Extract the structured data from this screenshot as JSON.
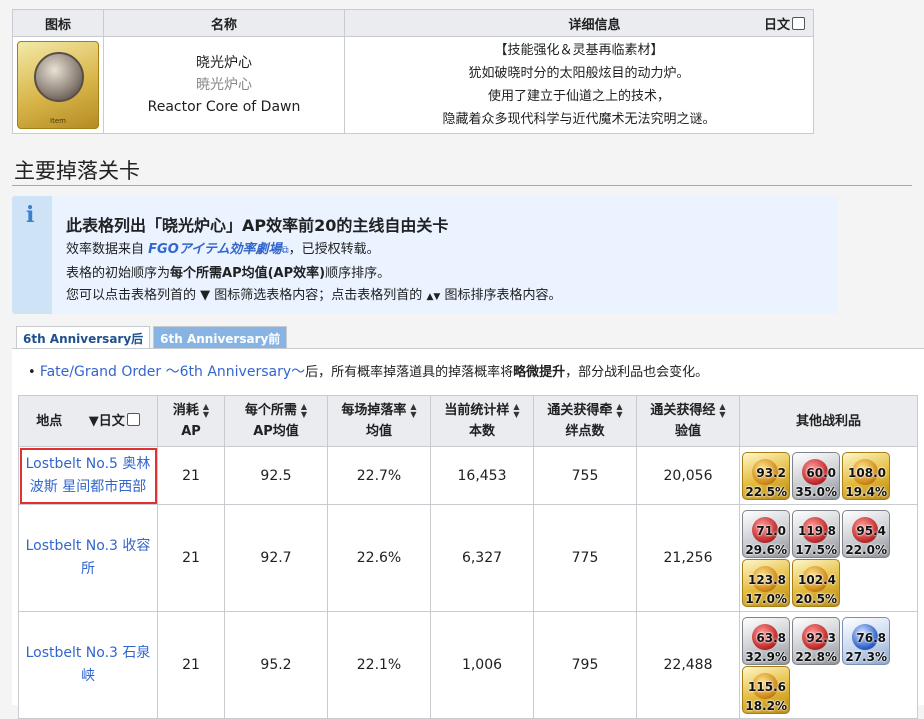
{
  "item_table": {
    "headers": {
      "icon": "图标",
      "name": "名称",
      "detail": "详细信息",
      "jp_toggle": "日文"
    },
    "icon_label": "Item",
    "name_cn": "晓光炉心",
    "name_jp": "暁光炉心",
    "name_en": "Reactor Core of Dawn",
    "detail_lines": [
      "【技能强化＆灵基再临素材】",
      "犹如破晓时分的太阳般炫目的动力炉。",
      "使用了建立于仙道之上的技术，",
      "隐藏着众多现代科学与近代魔术无法究明之谜。"
    ]
  },
  "section_title": "主要掉落关卡",
  "notice": {
    "icon": "info-icon",
    "title": "此表格列出「晓光炉心」AP效率前20的主线自由关卡",
    "line1_pre": "效率数据来自 ",
    "line1_link": "FGOアイテム効率劇場",
    "line1_post": "，已授权转载。",
    "line2_pre": "表格的初始顺序为",
    "line2_bold": "每个所需AP均值(AP效率)",
    "line2_post": "顺序排序。",
    "line3_a": "您可以点击表格列首的",
    "line3_b": "图标筛选表格内容；点击表格列首的",
    "line3_c": "图标排序表格内容。"
  },
  "tabs": [
    "6th Anniversary后",
    "6th Anniversary前"
  ],
  "bullet": {
    "link": "Fate/Grand Order ～6th Anniversary～",
    "pre": "后，所有概率掉落道具的掉落概率将",
    "bold": "略微提升",
    "post": "，部分战利品也会变化。"
  },
  "drop_table": {
    "headers": {
      "location": "地点",
      "jp": "日文",
      "ap_1": "消耗",
      "ap_2": "AP",
      "avg_1": "每个所需",
      "avg_2": "AP均值",
      "rate_1": "每场掉落率",
      "rate_2": "均值",
      "samples_1": "当前统计样",
      "samples_2": "本数",
      "bond_1": "通关获得牵",
      "bond_2": "绊点数",
      "exp_1": "通关获得经",
      "exp_2": "验值",
      "other": "其他战利品"
    },
    "rows": [
      {
        "loc_1": "Lostbelt No.5 奥林",
        "loc_2": "波斯 星间都市西部",
        "ap": "21",
        "avg": "92.5",
        "rate": "22.7%",
        "samples": "16,453",
        "bond": "755",
        "exp": "20,056",
        "drops": [
          {
            "v1": "93.2",
            "v2": "22.5%",
            "frame": "gold"
          },
          {
            "v1": "60.0",
            "v2": "35.0%",
            "frame": "silver"
          },
          {
            "v1": "108.0",
            "v2": "19.4%",
            "frame": "gold"
          }
        ]
      },
      {
        "loc_1": "Lostbelt No.3 收容",
        "loc_2": "所",
        "ap": "21",
        "avg": "92.7",
        "rate": "22.6%",
        "samples": "6,327",
        "bond": "775",
        "exp": "21,256",
        "drops": [
          {
            "v1": "71.0",
            "v2": "29.6%",
            "frame": "silver"
          },
          {
            "v1": "119.8",
            "v2": "17.5%",
            "frame": "silver"
          },
          {
            "v1": "95.4",
            "v2": "22.0%",
            "frame": "silver"
          },
          {
            "v1": "123.8",
            "v2": "17.0%",
            "frame": "gold"
          },
          {
            "v1": "102.4",
            "v2": "20.5%",
            "frame": "gold"
          }
        ]
      },
      {
        "loc_1": "Lostbelt No.3 石泉",
        "loc_2": "峡",
        "ap": "21",
        "avg": "95.2",
        "rate": "22.1%",
        "samples": "1,006",
        "bond": "795",
        "exp": "22,488",
        "drops": [
          {
            "v1": "63.8",
            "v2": "32.9%",
            "frame": "silver"
          },
          {
            "v1": "92.3",
            "v2": "22.8%",
            "frame": "silver"
          },
          {
            "v1": "76.8",
            "v2": "27.3%",
            "frame": "blue"
          },
          {
            "v1": "115.6",
            "v2": "18.2%",
            "frame": "gold"
          }
        ]
      }
    ]
  },
  "colors": {
    "link": "#3366cc",
    "notice_bg": "#eaf3ff",
    "tab_inactive": "#87b4e3",
    "highlight": "#e03030"
  }
}
